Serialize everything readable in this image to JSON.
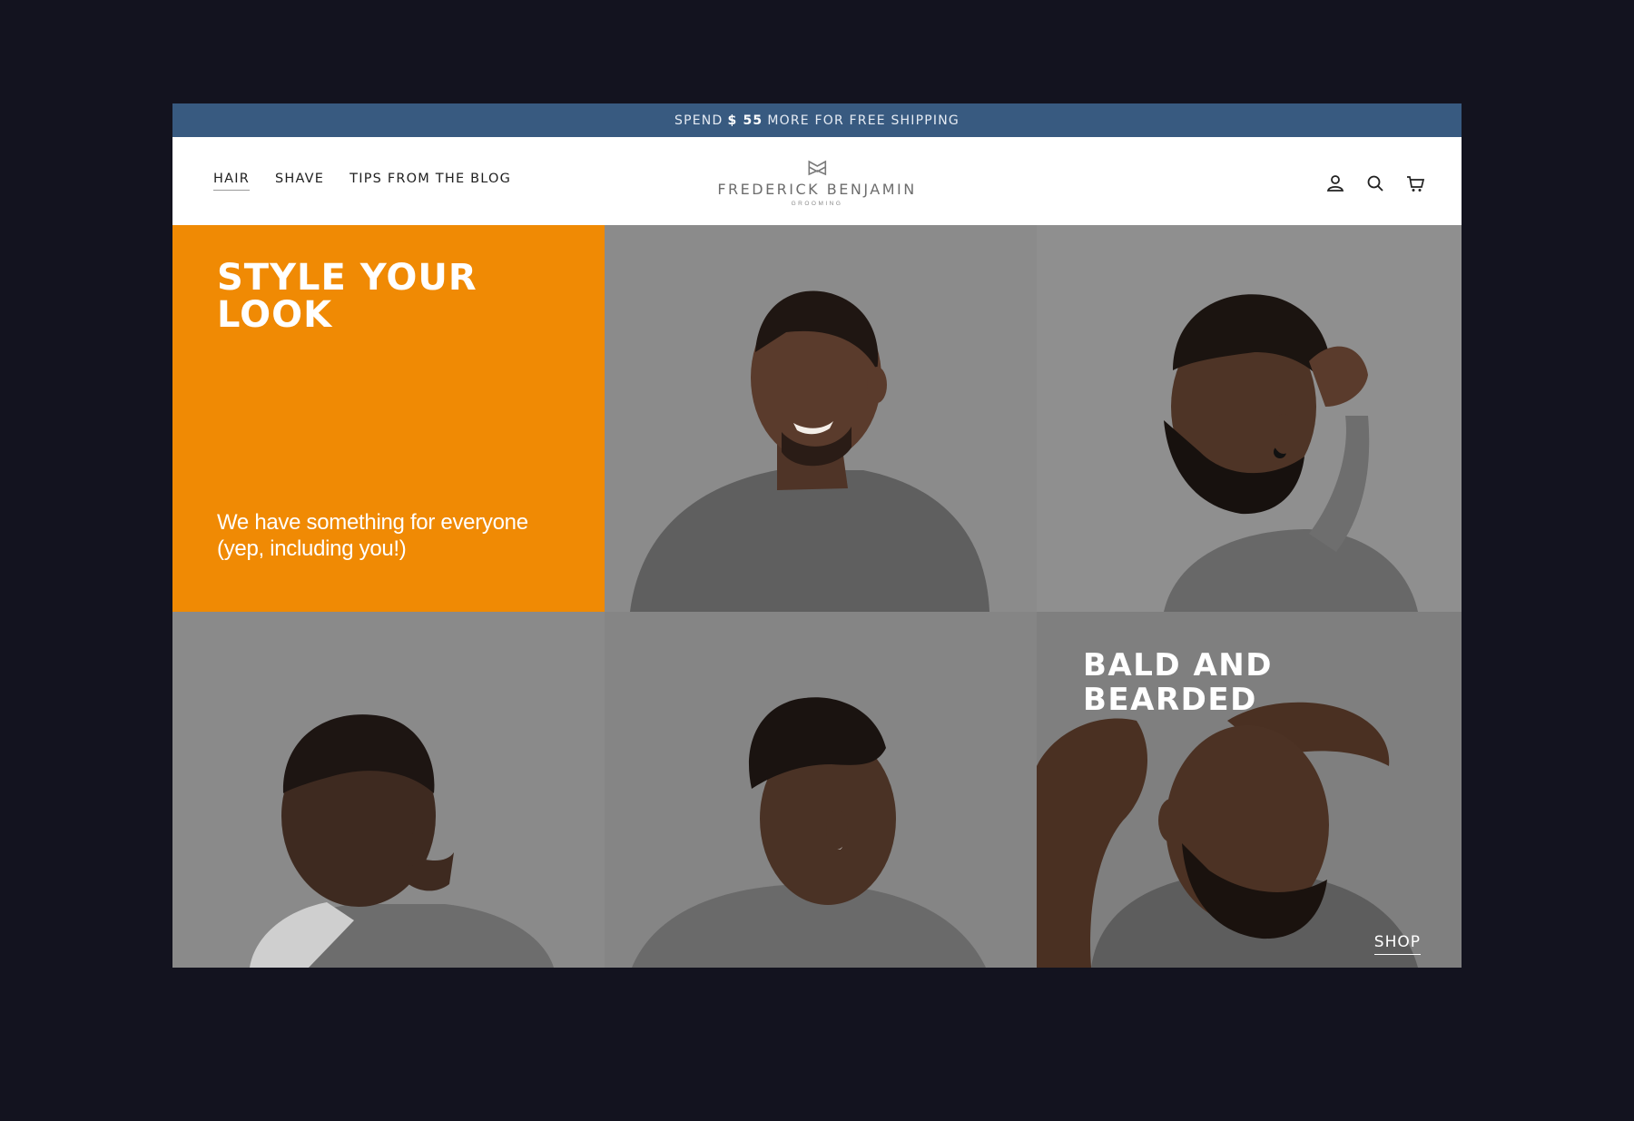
{
  "announcement": {
    "prefix": "SPEND",
    "amount": "$ 55",
    "suffix": "MORE FOR FREE SHIPPING"
  },
  "nav": {
    "items": [
      {
        "label": "HAIR"
      },
      {
        "label": "SHAVE"
      },
      {
        "label": "TIPS FROM THE BLOG"
      }
    ]
  },
  "logo": {
    "name": "FREDERICK BENJAMIN",
    "sub": "GROOMING"
  },
  "header_icons": [
    "account-icon",
    "search-icon",
    "cart-icon"
  ],
  "hero": {
    "title": "STYLE YOUR LOOK",
    "subtitle": "We have something for everyone (yep, including you!)"
  },
  "feature": {
    "title_line1": "BALD AND",
    "title_line2": "BEARDED",
    "shop_label": "SHOP"
  },
  "colors": {
    "page_bg": "#13131f",
    "announce_bg": "#385a80",
    "accent_orange": "#f08a04",
    "photo_bg": "#8c8c8c"
  }
}
